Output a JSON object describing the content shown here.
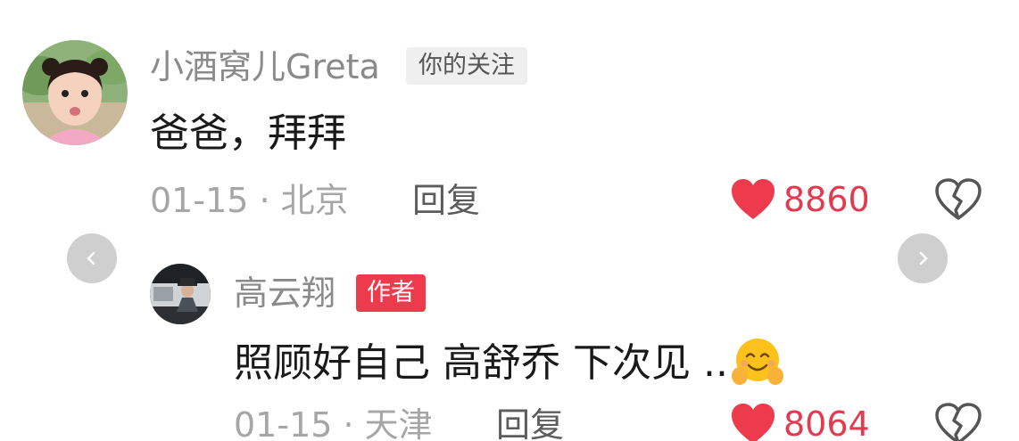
{
  "comment": {
    "username": "小酒窝儿Greta",
    "badge": "你的关注",
    "text": "爸爸，拜拜",
    "meta": "01-15 · 北京",
    "reply_label": "回复",
    "likes": "8860",
    "avatar_icon": "girl-avatar"
  },
  "reply": {
    "username": "高云翔",
    "badge": "作者",
    "text": "照顾好自己 高舒乔 下次见 ..",
    "emoji_icon": "hugging-face-emoji",
    "meta": "01-15 · 天津",
    "reply_label": "回复",
    "likes": "8064",
    "avatar_icon": "man-avatar"
  },
  "icons": {
    "like": "heart-icon",
    "dislike": "broken-heart-icon",
    "prev": "chevron-left-icon",
    "next": "chevron-right-icon"
  },
  "colors": {
    "like_red": "#ee3a4d",
    "author_badge": "#ee3a4d",
    "nav_button": "#cfcfcf"
  }
}
